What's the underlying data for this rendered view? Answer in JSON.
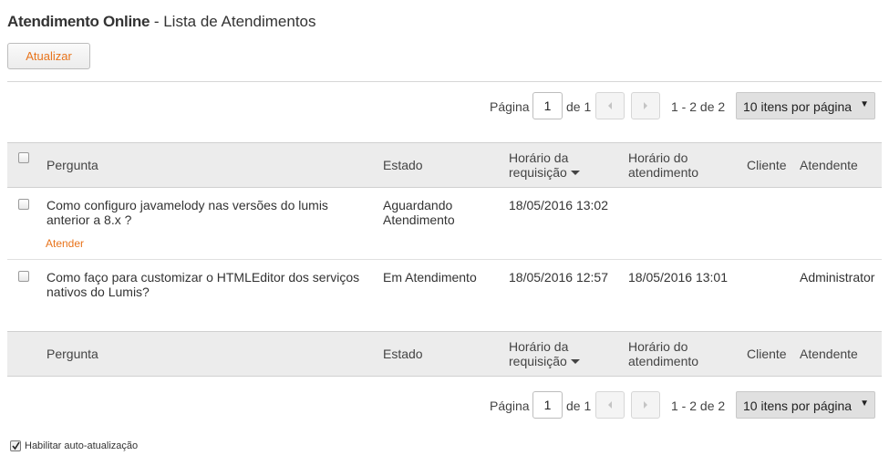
{
  "header": {
    "app_name": "Atendimento Online",
    "separator": " - ",
    "page_title": "Lista de Atendimentos"
  },
  "toolbar": {
    "refresh_label": "Atualizar"
  },
  "pager": {
    "page_label": "Página",
    "page_value": "1",
    "of_label": "de 1",
    "range_text": "1 - 2 de 2",
    "per_page_selected": "10 itens por página"
  },
  "columns": {
    "pergunta": "Pergunta",
    "estado": "Estado",
    "req_line1": "Horário da",
    "req_line2": "requisição",
    "aten_line1": "Horário do",
    "aten_line2": "atendimento",
    "cliente": "Cliente",
    "atendente": "Atendente"
  },
  "rows": [
    {
      "pergunta_l1": "Como configuro javamelody nas versões do lumis",
      "pergunta_l2": "anterior a 8.x ?",
      "estado_l1": "Aguardando",
      "estado_l2": "Atendimento",
      "horario_requisicao": "18/05/2016 13:02",
      "horario_atendimento": "",
      "cliente": "",
      "atendente": "",
      "action": "Atender"
    },
    {
      "pergunta_l1": "Como faço para customizar o HTMLEditor dos serviços",
      "pergunta_l2": "nativos do Lumis?",
      "estado_l1": "Em Atendimento",
      "estado_l2": "",
      "horario_requisicao": "18/05/2016 12:57",
      "horario_atendimento": "18/05/2016 13:01",
      "cliente": "",
      "atendente": "Administrator",
      "action": ""
    }
  ],
  "footer": {
    "auto_update_label": "Habilitar auto-atualização",
    "auto_update_checked": true
  },
  "icons": {
    "prev": "prev-page-icon",
    "next": "next-page-icon",
    "sort": "sort-desc-icon",
    "dropdown": "chevron-down-icon",
    "check": "checkmark-icon"
  },
  "colors": {
    "accent": "#e8741c",
    "header_bg": "#ececec"
  }
}
